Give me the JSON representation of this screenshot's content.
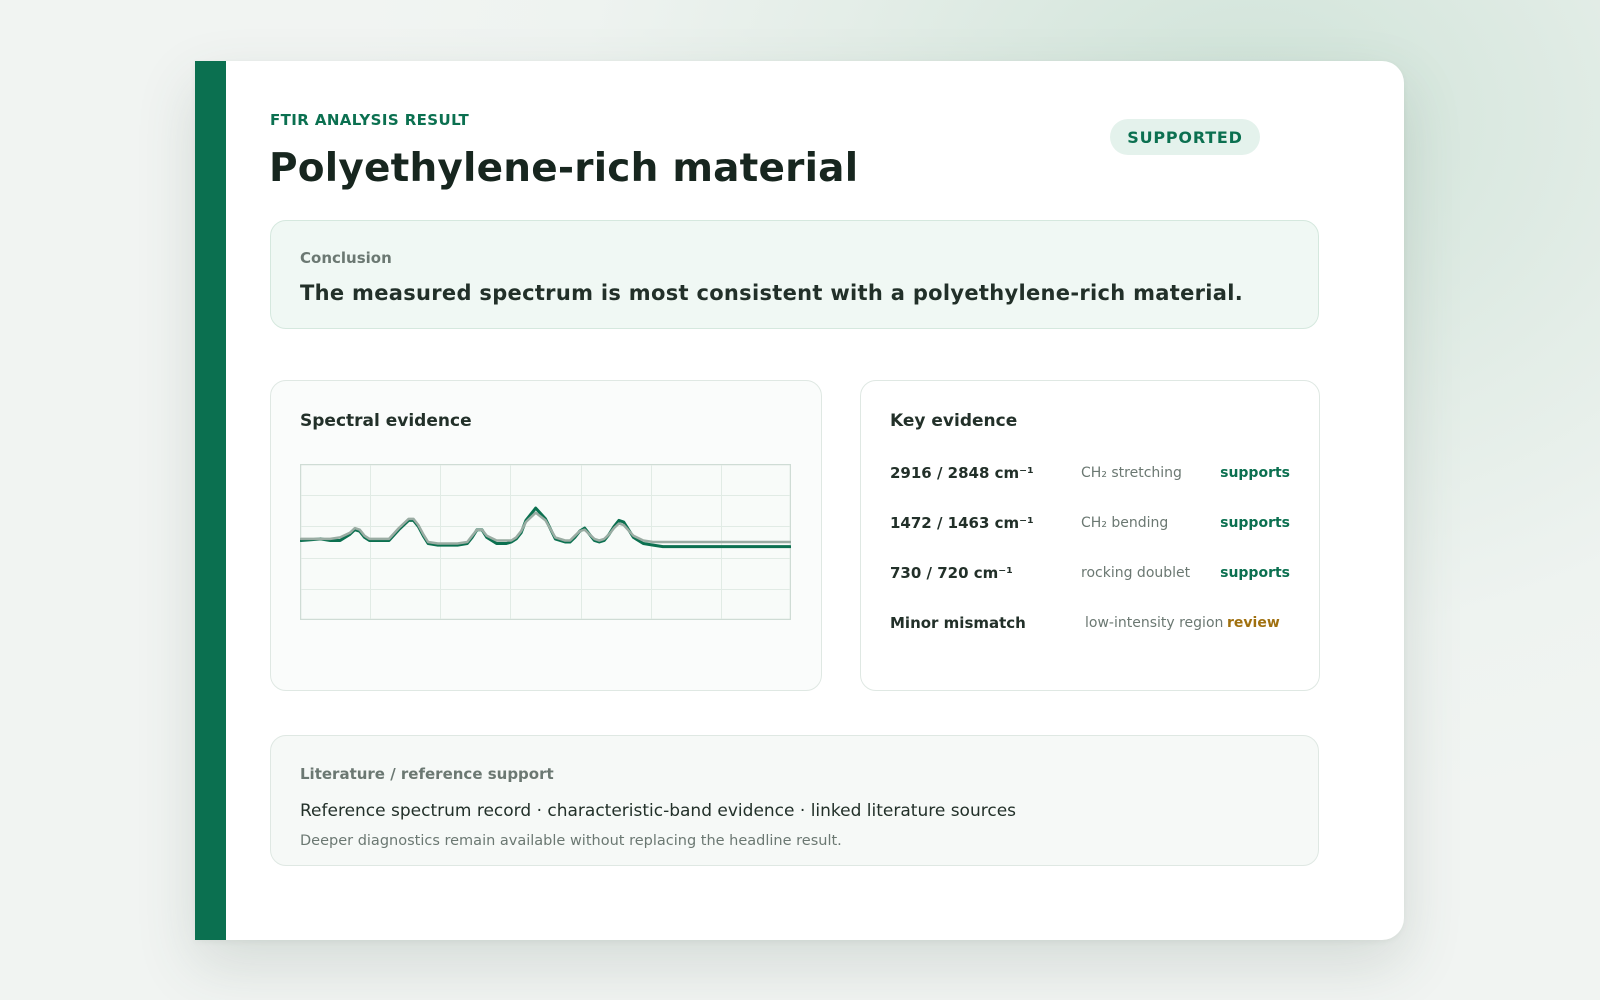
{
  "header": {
    "eyebrow": "FTIR ANALYSIS RESULT",
    "title": "Polyethylene-rich material",
    "status_badge": "SUPPORTED"
  },
  "conclusion": {
    "label": "Conclusion",
    "text": "The measured spectrum is most consistent with a polyethylene-rich material."
  },
  "spectral_panel": {
    "title": "Spectral evidence"
  },
  "key_evidence": {
    "title": "Key evidence",
    "rows": [
      {
        "band": "2916 / 2848 cm⁻¹",
        "assignment": "CH₂ stretching",
        "status": "supports"
      },
      {
        "band": "1472 / 1463 cm⁻¹",
        "assignment": "CH₂ bending",
        "status": "supports"
      },
      {
        "band": "730 / 720 cm⁻¹",
        "assignment": "rocking doublet",
        "status": "supports"
      },
      {
        "band": "Minor mismatch",
        "assignment": "low-intensity region",
        "status": "review"
      }
    ]
  },
  "literature": {
    "label": "Literature / reference support",
    "line": "Reference spectrum record · characteristic-band evidence · linked literature sources",
    "note": "Deeper diagnostics remain available without replacing the headline result."
  },
  "colors": {
    "accent": "#0b7050",
    "measured_line": "#0b7050",
    "reference_line": "#9aaca3",
    "review": "#a0700f"
  },
  "chart_data": {
    "type": "line",
    "title": "",
    "xlabel": "",
    "ylabel": "",
    "grid": true,
    "ylim": [
      0,
      1
    ],
    "x": [
      0,
      2,
      4,
      6,
      8,
      10,
      11,
      12,
      13,
      14,
      16,
      18,
      20,
      22,
      23,
      24,
      25,
      26,
      28,
      30,
      32,
      34,
      35,
      36,
      37,
      38,
      40,
      42,
      43,
      44,
      45,
      46,
      48,
      50,
      52,
      53,
      54,
      55,
      56,
      57,
      58,
      59,
      60,
      61,
      62,
      63,
      64,
      65,
      66,
      68,
      70,
      72,
      74,
      76,
      78,
      80,
      82,
      84,
      86,
      88,
      90,
      92,
      94,
      96,
      98,
      100
    ],
    "series": [
      {
        "name": "",
        "values": [
          0.51,
          0.515,
          0.52,
          0.51,
          0.51,
          0.55,
          0.58,
          0.57,
          0.53,
          0.51,
          0.51,
          0.51,
          0.58,
          0.64,
          0.64,
          0.6,
          0.54,
          0.49,
          0.48,
          0.48,
          0.48,
          0.49,
          0.53,
          0.58,
          0.58,
          0.53,
          0.49,
          0.49,
          0.5,
          0.52,
          0.56,
          0.64,
          0.72,
          0.65,
          0.52,
          0.51,
          0.5,
          0.5,
          0.53,
          0.57,
          0.59,
          0.55,
          0.51,
          0.5,
          0.51,
          0.55,
          0.6,
          0.64,
          0.63,
          0.53,
          0.49,
          0.48,
          0.47,
          0.47,
          0.47,
          0.47,
          0.47,
          0.47,
          0.47,
          0.47,
          0.47,
          0.47,
          0.47,
          0.47,
          0.47,
          0.47
        ]
      },
      {
        "name": "",
        "values": [
          0.52,
          0.52,
          0.52,
          0.52,
          0.53,
          0.56,
          0.59,
          0.58,
          0.54,
          0.52,
          0.52,
          0.52,
          0.59,
          0.65,
          0.65,
          0.61,
          0.55,
          0.5,
          0.49,
          0.49,
          0.49,
          0.5,
          0.54,
          0.58,
          0.58,
          0.54,
          0.51,
          0.51,
          0.51,
          0.53,
          0.57,
          0.63,
          0.69,
          0.64,
          0.53,
          0.52,
          0.51,
          0.51,
          0.54,
          0.57,
          0.58,
          0.55,
          0.52,
          0.51,
          0.52,
          0.55,
          0.59,
          0.62,
          0.61,
          0.54,
          0.51,
          0.5,
          0.5,
          0.5,
          0.5,
          0.5,
          0.5,
          0.5,
          0.5,
          0.5,
          0.5,
          0.5,
          0.5,
          0.5,
          0.5,
          0.5
        ]
      }
    ]
  }
}
